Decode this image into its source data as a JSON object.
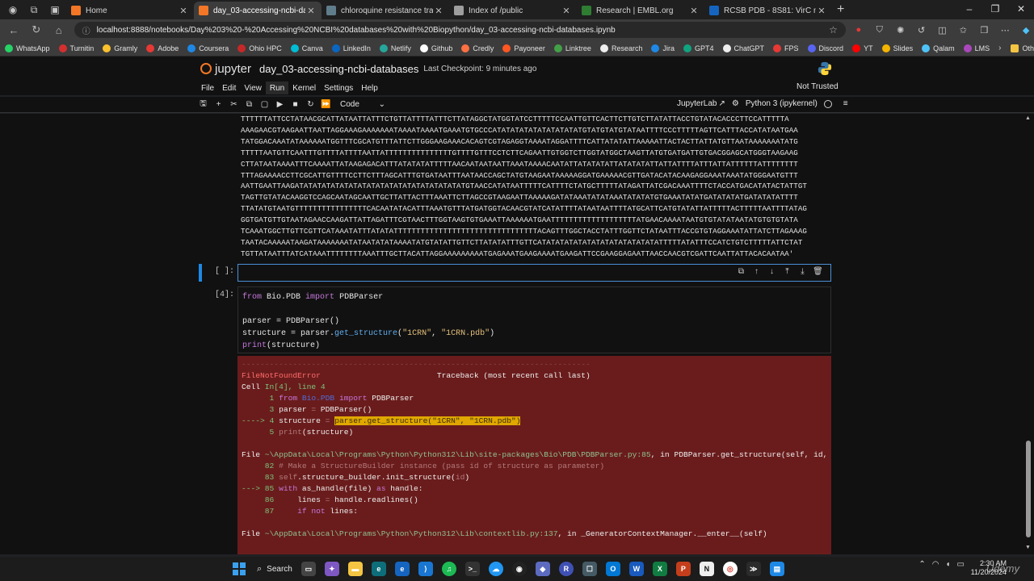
{
  "browser": {
    "tabs": [
      {
        "title": "Home",
        "color": "#f37726"
      },
      {
        "title": "day_03-accessing-ncbi-databases",
        "color": "#f37726",
        "active": true
      },
      {
        "title": "chloroquine resistance transporte",
        "color": "#607d8b"
      },
      {
        "title": "Index of /public",
        "color": "#9e9e9e"
      },
      {
        "title": "Research | EMBL.org",
        "color": "#2e7d32"
      },
      {
        "title": "RCSB PDB - 8S81: VirC mutant C",
        "color": "#1565c0"
      }
    ],
    "url": "localhost:8888/notebooks/Day%203%20-%20Accessing%20NCBI%20databases%20with%20Biopython/day_03-accessing-ncbi-databases.ipynb"
  },
  "bookmarks": [
    {
      "label": "WhatsApp",
      "color": "#25d366"
    },
    {
      "label": "Turnitin",
      "color": "#d32f2f"
    },
    {
      "label": "Gramly",
      "color": "#fbc02d"
    },
    {
      "label": "Adobe",
      "color": "#e53935"
    },
    {
      "label": "Coursera",
      "color": "#1e88e5"
    },
    {
      "label": "Ohio HPC",
      "color": "#c62828"
    },
    {
      "label": "Canva",
      "color": "#00bcd4"
    },
    {
      "label": "LinkedIn",
      "color": "#0a66c2"
    },
    {
      "label": "Netlify",
      "color": "#26a69a"
    },
    {
      "label": "Github",
      "color": "#ffffff"
    },
    {
      "label": "Credly",
      "color": "#ff7043"
    },
    {
      "label": "Payoneer",
      "color": "#ff5722"
    },
    {
      "label": "Linktree",
      "color": "#43a047"
    },
    {
      "label": "Research",
      "color": "#eeeeee"
    },
    {
      "label": "Jira",
      "color": "#1e88e5"
    },
    {
      "label": "GPT4",
      "color": "#10a37f"
    },
    {
      "label": "ChatGPT",
      "color": "#eeeeee"
    },
    {
      "label": "FPS",
      "color": "#e53935"
    },
    {
      "label": "Discord",
      "color": "#5865f2"
    },
    {
      "label": "YT",
      "color": "#ff0000"
    },
    {
      "label": "Slides",
      "color": "#f4b400"
    },
    {
      "label": "Qalam",
      "color": "#4fc3f7"
    },
    {
      "label": "LMS",
      "color": "#ab47bc"
    }
  ],
  "other_favorites": "Other favorites",
  "jupyter": {
    "logo_text": "jupyter",
    "notebook_title": "day_03-accessing-ncbi-databases",
    "checkpoint": "Last Checkpoint: 9 minutes ago",
    "menu": [
      "File",
      "Edit",
      "View",
      "Run",
      "Kernel",
      "Settings",
      "Help"
    ],
    "not_trusted": "Not Trusted",
    "cell_type": "Code",
    "jupyterlab_link": "JupyterLab",
    "kernel": "Python 3 (ipykernel)"
  },
  "sequence_lines": [
    "TTTTTTATTCCTATAACGCATTATAATTATTTCTGTTATTTTATTTCTTATAGGCTATGGTATCCTTTTTCCAATTGTTCACTTCTTGTCTTATATTACCTGTATACACCCTTCCATTTTTA",
    "AAAGAACGTAAGAATTAATTAGGAAAGAAAAAAATAAAATAAAATGAAATGTGCCCATATATATATATATATATATGTATGTATGTATAATTTTCCCTTTTTAGTTCATTTACCATATAATGAA",
    "TATGGACAAATATAAAAAATGGTTTCGCATGTTTATTCTTGGGAAGAAACACAGTCGTAGAGGTAAAATAGGATTTTCATTATATATTAAAAATTACTACTTATTATGTTAATAAAAAAATATG",
    "TTTTTAATGTTCAATTTGTTTTATTTTAATTATTTTTTTTTTTTTTTGTTTTGTTTCCTCTTCAGAATTGTGGTCTTGGTATGGCTAAGTTATGTGATGATTGTGACGGAGCATGGGTAAGAAG",
    "CTTATAATAAAATTTCAAAATTATAAGAGACATTTATATATATTTTTAACAATAATAATTAAATAAAACAATATTATATATATTATATATATTATTATTTTATTTATTATTTTTTATTTTTTTT",
    "TTTAGAAAACCTTCGCATTGTTTTCCTTCTTTAGCATTTGTGATAATTTAATAACCAGCTATGTAAGAATAAAAAGGATGAAAAACGTTGATACATACAAGAGGAAATAAATATGGGAATGTTT",
    "AATTGAATTAAGATATATATATATATATATATATATATATATATATATATGTAACCATATAATTTTTCATTTTCTATGCTTTTTATAGATTATCGACAAATTTTCTACCATGACATATACTATTGT",
    "TAGTTGTATACAAGGTCCAGCAATAGCAATTGCTTATTACTTTAAATTCTTAGCCGTAAGAATTAAAAAGATATAAATATATAAATATATATGTGAAATATATGATATATATGATATATATTTT",
    "TTATATGTAATGTTTTTTTTTTTTTTTTCACAATATACATTTAAATGTTTATGATGGTACAACGTATCATATTTTATAATAATTTTATGCATTCATGTATATTATTTTTACTTTTTAATTTTATAG",
    "GGTGATGTTGTAATAGAACCAAGATTATTAGATTTCGTAACTTTGGTAAGTGTGAAATTAAAAAATGAATTTTTTTTTTTTTTTTTTTATGAACAAAATAATGTGTATATAATATGTGTGTATA",
    "TCAAATGGCTTGTTCGTTCATAAATATTTATATATTTTTTTTTTTTTTTTTTTTTTTTTTTTTTTTACAGTTTGGCTACCTATTTGGTTCTATAATTTACCGTGTAGGAAATATTATCTTAGAAAG",
    "TAATACAAAAATAAGATAAAAAAATATAATATATAAAATATGTATATTGTTCTTATATATTTGTTCATATATATATATATATATATATATATATTTTTATATTTCCATCTGTCTTTTTATTCTAT",
    "TGTTATAATTTATCATAAATTTTTTTTAAATTTGCTTACATTAGGAAAAAAAAATGAGAAATGAAGAAAATGAAGATTCCGAAGGAGAATTAACCAACGTCGATTCAATTATTACACAATAA'"
  ],
  "cells": {
    "empty_prompt": "[ ]:",
    "code_prompt": "[4]:",
    "code_lines": [
      "from Bio.PDB import PDBParser",
      "",
      "parser = PDBParser()",
      "structure = parser.get_structure(\"1CRN\", \"1CRN.pdb\")",
      "print(structure)"
    ]
  },
  "error": {
    "dashes": "---------------------------------------------------------------------------",
    "name": "FileNotFoundError",
    "traceback_header": "Traceback (most recent call last)",
    "cell_ref": "Cell In[4], line 4",
    "frames": [
      {
        "file": "~\\AppData\\Local\\Programs\\Python\\Python312\\Lib\\site-packages\\Bio\\PDB\\PDBParser.py:85",
        "func": "PDBParser.get_structure(self, id, file)"
      },
      {
        "file": "~\\AppData\\Local\\Programs\\Python\\Python312\\Lib\\contextlib.py:137",
        "func": "_GeneratorContextManager.__enter__(self)"
      }
    ]
  },
  "taskbar": {
    "search": "Search",
    "time": "2:30 AM",
    "date": "11/20/2024",
    "watermark": "Udemy"
  }
}
